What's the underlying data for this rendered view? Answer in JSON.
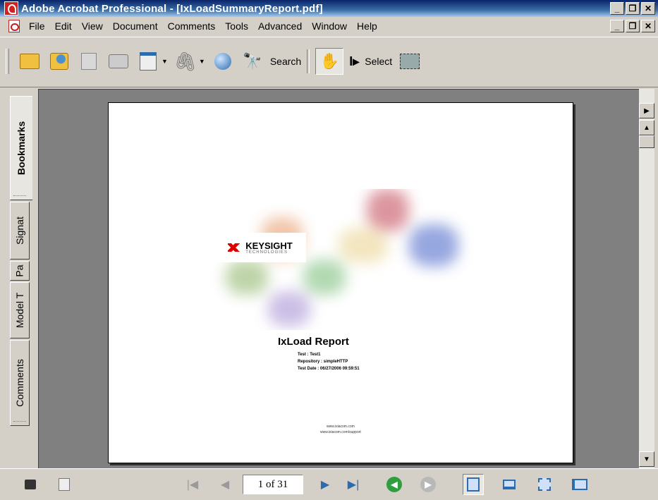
{
  "window": {
    "title": "Adobe Acrobat Professional - [IxLoadSummaryReport.pdf]"
  },
  "menu": {
    "items": [
      "File",
      "Edit",
      "View",
      "Document",
      "Comments",
      "Tools",
      "Advanced",
      "Window",
      "Help"
    ]
  },
  "toolbar": {
    "search_label": "Search",
    "select_label": "Select"
  },
  "nav_tabs": [
    "Bookmarks",
    "Signat",
    "Pa",
    "Model T",
    "Comments"
  ],
  "document": {
    "logo_brand": "KEYSIGHT",
    "logo_sub": "TECHNOLOGIES",
    "report_title": "IxLoad Report",
    "report_lines": [
      "Test : Test1",
      "Repository : simpleHTTP",
      "Test Date : 06/27/2006 09:59:51"
    ],
    "footer_lines": [
      "www.ixiacom.com",
      "www.ixiacom.com/support"
    ]
  },
  "navigation": {
    "page_indicator": "1 of 31"
  },
  "icons": {
    "toolbar": [
      "open-icon",
      "collaborate-icon",
      "save-icon",
      "print-icon",
      "create-pdf-icon",
      "attach-icon",
      "email-icon",
      "search-icon",
      "hand-tool-icon",
      "select-tool-icon",
      "snapshot-icon"
    ],
    "status": [
      "tray-icon",
      "page-icon",
      "first-page-icon",
      "previous-page-icon",
      "next-page-icon",
      "last-page-icon",
      "go-back-icon",
      "go-forward-icon",
      "single-page-icon",
      "continuous-icon",
      "continuous-facing-icon",
      "facing-icon"
    ]
  },
  "colors": {
    "title_start": "#0a246a",
    "title_end": "#a6caf0",
    "chrome": "#d4d0c8",
    "doc_bg": "#808080",
    "logo_red": "#e00000",
    "nav_green": "#2e9e3e"
  }
}
